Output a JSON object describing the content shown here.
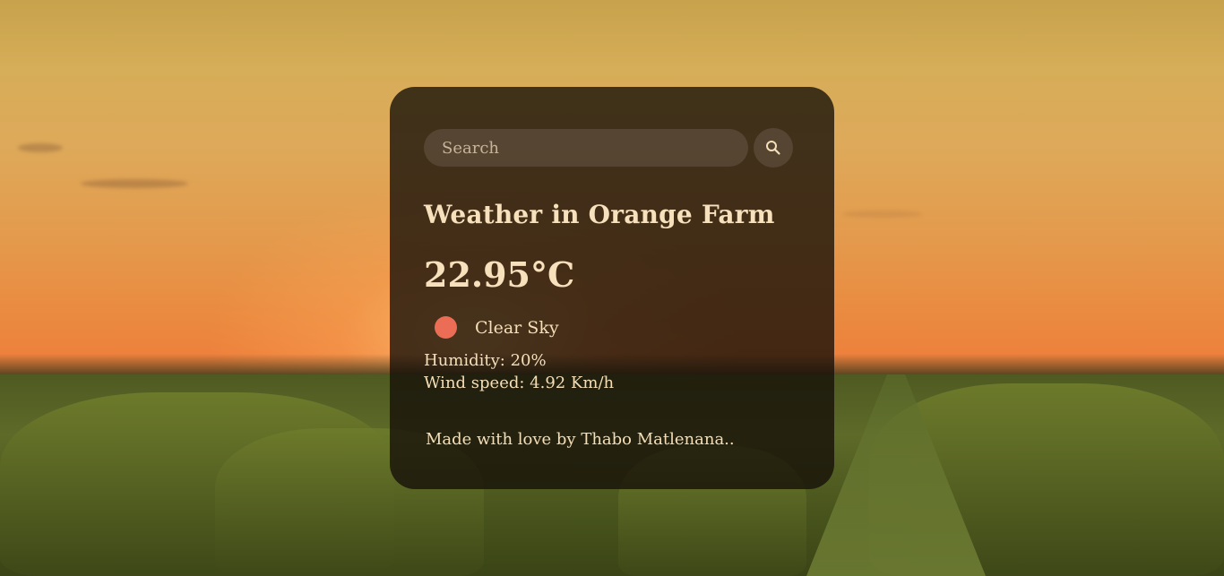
{
  "search": {
    "placeholder": "Search",
    "icon": "search-icon"
  },
  "weather": {
    "title": "Weather in Orange Farm",
    "temperature": "22.95°C",
    "condition": "Clear Sky",
    "condition_icon": "weather-condition-icon",
    "humidity": "Humidity: 20%",
    "wind": "Wind speed: 4.92 Km/h"
  },
  "footer": {
    "credit": "Made with love by Thabo Matlenana.."
  },
  "colors": {
    "card_background": "#140e08",
    "text": "#f5dfb8",
    "condition_icon": "#ec6d55"
  }
}
